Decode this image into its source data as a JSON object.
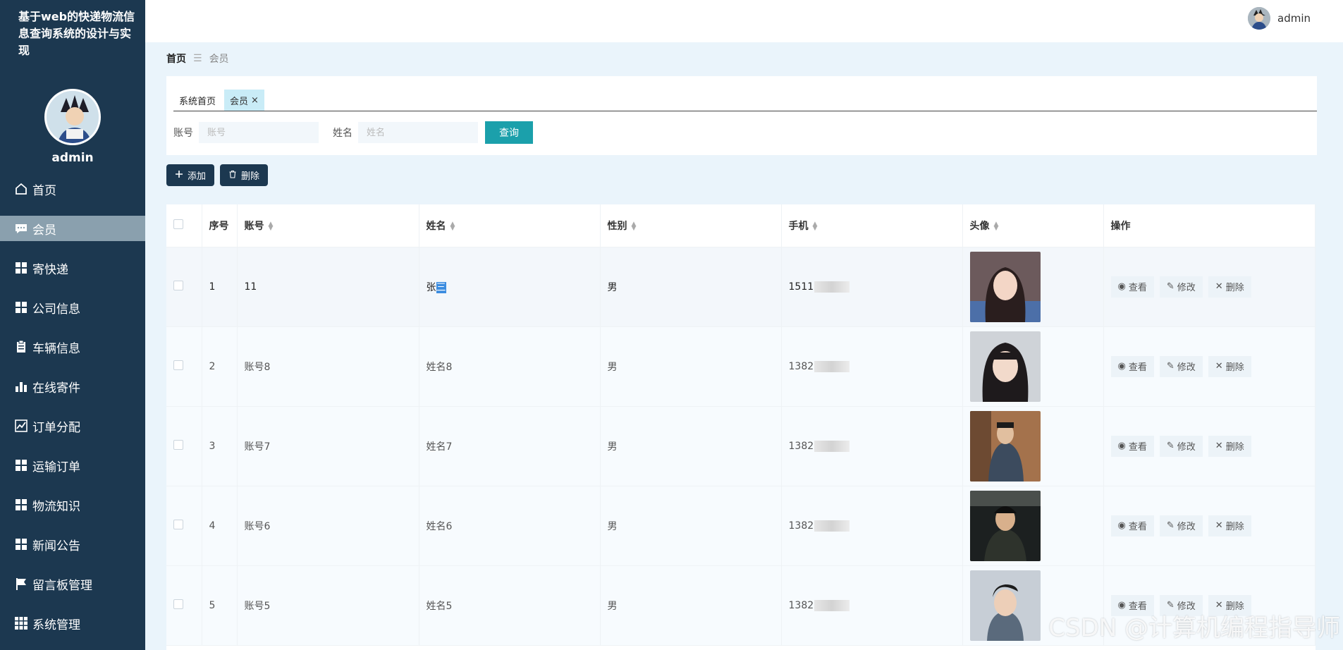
{
  "app": {
    "title": "基于web的快递物流信息查询系统的设计与实现",
    "user": "admin"
  },
  "sidebar": {
    "username": "admin",
    "items": [
      {
        "label": "首页",
        "icon": "home-icon"
      },
      {
        "label": "会员",
        "icon": "chat-icon",
        "active": true
      },
      {
        "label": "寄快递",
        "icon": "grid-icon"
      },
      {
        "label": "公司信息",
        "icon": "grid-icon"
      },
      {
        "label": "车辆信息",
        "icon": "clipboard-icon"
      },
      {
        "label": "在线寄件",
        "icon": "bar-chart-icon"
      },
      {
        "label": "订单分配",
        "icon": "line-chart-icon"
      },
      {
        "label": "运输订单",
        "icon": "grid-icon"
      },
      {
        "label": "物流知识",
        "icon": "grid-icon"
      },
      {
        "label": "新闻公告",
        "icon": "grid-icon"
      },
      {
        "label": "留言板管理",
        "icon": "flag-icon"
      },
      {
        "label": "系统管理",
        "icon": "apps-icon"
      }
    ]
  },
  "breadcrumb": {
    "home": "首页",
    "sep": "☰",
    "current": "会员"
  },
  "tabs": [
    {
      "label": "系统首页"
    },
    {
      "label": "会员",
      "close": "×"
    }
  ],
  "search": {
    "account_label": "账号",
    "account_placeholder": "账号",
    "name_label": "姓名",
    "name_placeholder": "姓名",
    "query_label": "查询"
  },
  "toolbar": {
    "add_label": "添加",
    "delete_label": "删除"
  },
  "table": {
    "headers": {
      "index": "序号",
      "account": "账号",
      "name": "姓名",
      "gender": "性别",
      "phone": "手机",
      "avatar": "头像",
      "ops": "操作"
    },
    "op_labels": {
      "view": "查看",
      "edit": "修改",
      "delete": "删除"
    },
    "rows": [
      {
        "index": "1",
        "account": "11",
        "name_a": "张",
        "name_b": "三",
        "gender": "男",
        "phone": "1511"
      },
      {
        "index": "2",
        "account": "账号8",
        "name": "姓名8",
        "gender": "男",
        "phone": "1382"
      },
      {
        "index": "3",
        "account": "账号7",
        "name": "姓名7",
        "gender": "男",
        "phone": "1382"
      },
      {
        "index": "4",
        "account": "账号6",
        "name": "姓名6",
        "gender": "男",
        "phone": "1382"
      },
      {
        "index": "5",
        "account": "账号5",
        "name": "姓名5",
        "gender": "男",
        "phone": "1382"
      }
    ]
  },
  "watermark": "CSDN @计算机编程指导师",
  "colors": {
    "sidebar": "#1c3850",
    "accent": "#1ba0ab",
    "active_item": "#8aa0ae",
    "page_bg": "#eaf4fb"
  }
}
